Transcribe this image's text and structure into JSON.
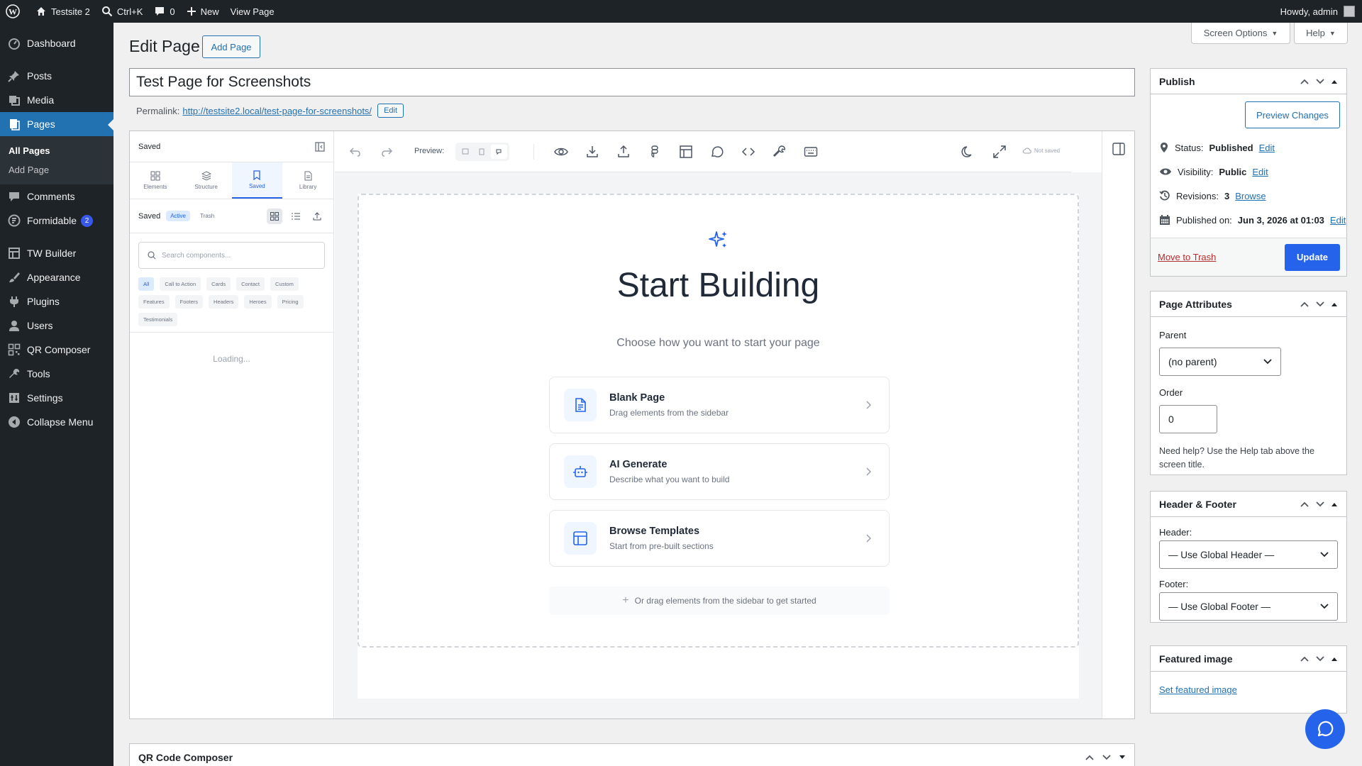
{
  "adminbar": {
    "site_name": "Testsite 2",
    "shortcut": "Ctrl+K",
    "comments_count": "0",
    "new_label": "New",
    "view_page": "View Page",
    "howdy": "Howdy, admin"
  },
  "menu": {
    "dashboard": "Dashboard",
    "posts": "Posts",
    "media": "Media",
    "pages": "Pages",
    "all_pages": "All Pages",
    "add_page": "Add Page",
    "comments": "Comments",
    "formidable": "Formidable",
    "formidable_badge": "2",
    "tw_builder": "TW Builder",
    "appearance": "Appearance",
    "plugins": "Plugins",
    "users": "Users",
    "qr_composer": "QR Composer",
    "tools": "Tools",
    "settings": "Settings",
    "collapse": "Collapse Menu"
  },
  "header": {
    "title": "Edit Page",
    "add_page": "Add Page",
    "screen_options": "Screen Options",
    "help": "Help"
  },
  "post": {
    "title": "Test Page for Screenshots",
    "permalink_label": "Permalink:",
    "permalink_url": "http://testsite2.local/test-page-for-screenshots/",
    "permalink_edit": "Edit"
  },
  "builder": {
    "panel_title": "Saved",
    "tabs": [
      "Elements",
      "Structure",
      "Saved",
      "Library"
    ],
    "saved_label": "Saved",
    "active_label": "Active",
    "trash_label": "Trash",
    "search_placeholder": "Search components...",
    "chips": [
      "All",
      "Call to Action",
      "Cards",
      "Contact",
      "Custom",
      "Features",
      "Footers",
      "Headers",
      "Heroes",
      "Pricing",
      "Testimonials"
    ],
    "loading": "Loading...",
    "preview_label": "Preview:",
    "save_status": "Not saved",
    "start_title": "Start Building",
    "start_subtitle": "Choose how you want to start your page",
    "options": [
      {
        "title": "Blank Page",
        "desc": "Drag elements from the sidebar"
      },
      {
        "title": "AI Generate",
        "desc": "Describe what you want to build"
      },
      {
        "title": "Browse Templates",
        "desc": "Start from pre-built sections"
      }
    ],
    "drag_hint": "Or drag elements from the sidebar to get started"
  },
  "publish": {
    "title": "Publish",
    "preview_changes": "Preview Changes",
    "status_label": "Status:",
    "status_value": "Published",
    "visibility_label": "Visibility:",
    "visibility_value": "Public",
    "revisions_label": "Revisions:",
    "revisions_value": "3",
    "browse": "Browse",
    "published_on_label": "Published on:",
    "published_on_value": "Jun 3, 2026 at 01:03",
    "edit": "Edit",
    "move_to_trash": "Move to Trash",
    "update": "Update"
  },
  "attributes": {
    "title": "Page Attributes",
    "parent_label": "Parent",
    "parent_value": "(no parent)",
    "order_label": "Order",
    "order_value": "0",
    "help_text": "Need help? Use the Help tab above the screen title."
  },
  "header_footer": {
    "title": "Header & Footer",
    "header_label": "Header:",
    "header_value": "— Use Global Header —",
    "footer_label": "Footer:",
    "footer_value": "— Use Global Footer —"
  },
  "featured": {
    "title": "Featured image",
    "link": "Set featured image"
  },
  "qr_box": {
    "title": "QR Code Composer"
  },
  "colors": {
    "accent": "#2271b1",
    "primary_button": "#2563eb",
    "sidebar": "#1d2327"
  }
}
